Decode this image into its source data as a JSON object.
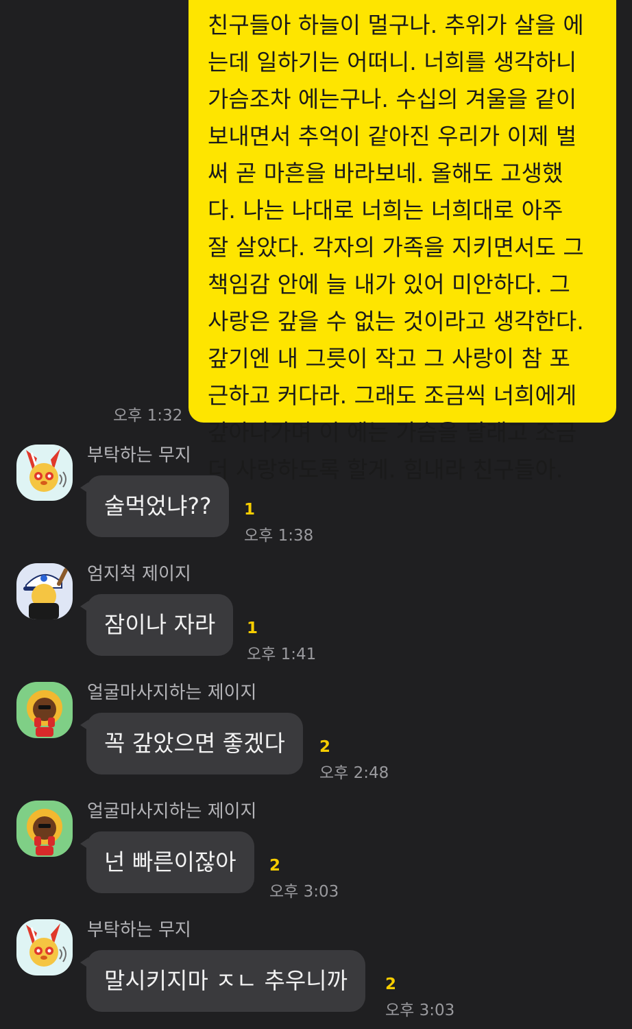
{
  "colors": {
    "background": "#1f1f21",
    "outgoing_bubble": "#fee500",
    "incoming_bubble": "#3a3a3d",
    "unread": "#f7cd00",
    "timestamp": "#9a9a9e"
  },
  "outgoing": {
    "text": "친구들아 하늘이 멀구나. 추위가 살을 에\n는데 일하기는 어떠니. 너희를 생각하니\n가슴조차 에는구나. 수십의 겨울을 같이\n보내면서 추억이 같아진 우리가 이제 벌\n써 곧 마흔을 바라보네. 올해도 고생했\n다. 나는 나대로 너희는 너희대로 아주\n잘 살았다. 각자의 가족을 지키면서도 그\n책임감 안에 늘 내가 있어 미안하다. 그\n사랑은 갚을 수 없는 것이라고 생각한다.\n갚기엔 내 그릇이 작고 그 사랑이 참 포\n근하고 커다라. 그래도 조금씩 너희에게\n갚아나가며 이 에는 가슴을 달래고 조금\n더 사랑하도록 할게. 힘내라 친구들아.",
    "time": "오후 1:32"
  },
  "messages": [
    {
      "sender": "부탁하는 무지",
      "avatar": "muzi-rabbit-avatar",
      "text": "술먹었냐??",
      "unread": "1",
      "time": "오후 1:38"
    },
    {
      "sender": "엄지척 제이지",
      "avatar": "jayg-cap-avatar",
      "text": "잠이나 자라",
      "unread": "1",
      "time": "오후 1:41"
    },
    {
      "sender": "얼굴마사지하는 제이지",
      "avatar": "jayg-massage-avatar",
      "text": "꼭 갚았으면 좋겠다",
      "unread": "2",
      "time": "오후 2:48"
    },
    {
      "sender": "얼굴마사지하는 제이지",
      "avatar": "jayg-massage-avatar",
      "text": "넌 빠른이잖아",
      "unread": "2",
      "time": "오후 3:03"
    },
    {
      "sender": "부탁하는 무지",
      "avatar": "muzi-rabbit-avatar",
      "text": "말시키지마 ㅈㄴ 추우니까",
      "unread": "2",
      "time": "오후 3:03"
    }
  ]
}
